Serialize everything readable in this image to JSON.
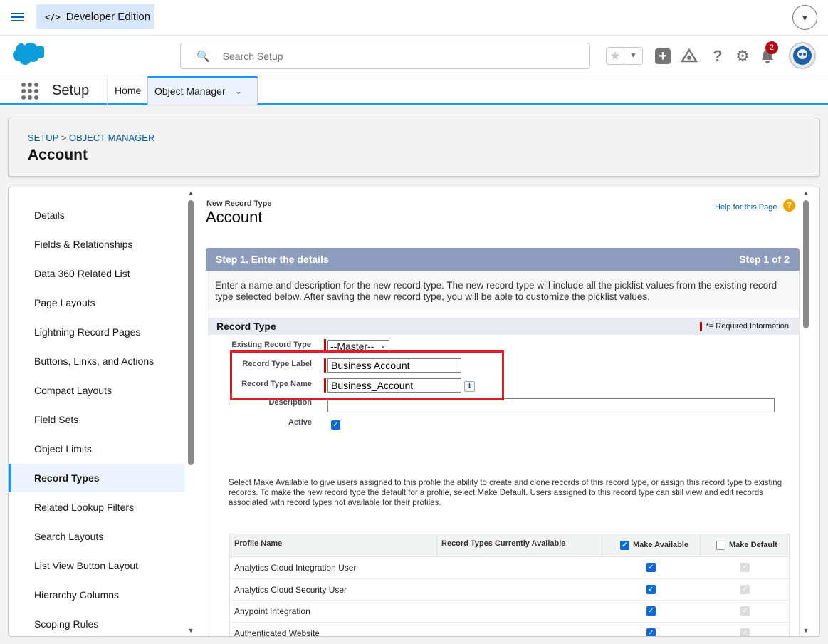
{
  "topbar": {
    "edition_label": "Developer Edition",
    "edition_icon": "</>"
  },
  "header": {
    "search_placeholder": "Search Setup",
    "notification_count": "2"
  },
  "nav": {
    "app_name": "Setup",
    "tabs": [
      {
        "label": "Home"
      },
      {
        "label": "Object Manager"
      }
    ]
  },
  "breadcrumb": {
    "setup": "SETUP",
    "sep": ">",
    "object_manager": "OBJECT MANAGER",
    "title": "Account"
  },
  "sidebar": {
    "items": [
      {
        "label": "Details"
      },
      {
        "label": "Fields & Relationships"
      },
      {
        "label": "Data 360 Related List"
      },
      {
        "label": "Page Layouts"
      },
      {
        "label": "Lightning Record Pages"
      },
      {
        "label": "Buttons, Links, and Actions"
      },
      {
        "label": "Compact Layouts"
      },
      {
        "label": "Field Sets"
      },
      {
        "label": "Object Limits"
      },
      {
        "label": "Record Types"
      },
      {
        "label": "Related Lookup Filters"
      },
      {
        "label": "Search Layouts"
      },
      {
        "label": "List View Button Layout"
      },
      {
        "label": "Hierarchy Columns"
      },
      {
        "label": "Scoping Rules"
      }
    ],
    "active": "Record Types"
  },
  "page": {
    "subtitle": "New Record Type",
    "title": "Account",
    "help_link": "Help for this Page",
    "step_title": "Step 1. Enter the details",
    "step_count": "Step 1 of 2",
    "step_desc": "Enter a name and description for the new record type. The new record type will include all the picklist values from the existing record type selected below. After saving the new record type, you will be able to customize the picklist values.",
    "section_title": "Record Type",
    "required_note": "= Required Information"
  },
  "form": {
    "existing_label": "Existing Record Type",
    "existing_value": "--Master--",
    "label_label": "Record Type Label",
    "label_value": "Business Account",
    "name_label": "Record Type Name",
    "name_value": "Business_Account",
    "description_label": "Description",
    "description_value": "",
    "active_label": "Active",
    "active_checked": true
  },
  "note": "Select Make Available to give users assigned to this profile the ability to create and clone records of this record type, or assign this record type to existing records. To make the new record type the default for a profile, select Make Default. Users assigned to this record type can still view and edit records associated with record types not available for their profiles.",
  "profile_table": {
    "headers": {
      "profile": "Profile Name",
      "current": "Record Types Currently Available",
      "available": "Make Available",
      "default": "Make Default"
    },
    "rows": [
      {
        "name": "Analytics Cloud Integration User",
        "available": true,
        "default": false
      },
      {
        "name": "Analytics Cloud Security User",
        "available": true,
        "default": false
      },
      {
        "name": "Anypoint Integration",
        "available": true,
        "default": false
      },
      {
        "name": "Authenticated Website",
        "available": true,
        "default": false
      }
    ]
  },
  "colors": {
    "brand": "#0b5cab",
    "accent": "#1b96ff",
    "step_bar": "#8e9dbe",
    "highlight": "#e01c26",
    "required": "#cc0000"
  }
}
